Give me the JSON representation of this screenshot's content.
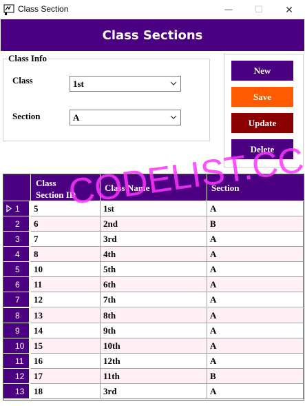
{
  "window": {
    "title": "Class Section",
    "controls": {
      "minimize": "—",
      "maximize": "☐",
      "close": "✕"
    },
    "icon": "app-icon"
  },
  "header": {
    "title": "Class Sections"
  },
  "class_info": {
    "title": "Class Info",
    "class_label": "Class",
    "class_value": "1st",
    "section_label": "Section",
    "section_value": "A"
  },
  "buttons": {
    "new": {
      "label": "New",
      "color": "#4b0082"
    },
    "save": {
      "label": "Save",
      "color": "#ff5a00"
    },
    "update": {
      "label": "Update",
      "color": "#8b0000"
    },
    "delete": {
      "label": "Delete",
      "color": "#4b0082"
    }
  },
  "table": {
    "columns": [
      "Class\nSection ID",
      "Class Name",
      "Section"
    ],
    "rows": [
      {
        "num": "1",
        "id": "5",
        "name": "1st",
        "section": "A"
      },
      {
        "num": "2",
        "id": "6",
        "name": "2nd",
        "section": "B"
      },
      {
        "num": "3",
        "id": "7",
        "name": "3rd",
        "section": "A"
      },
      {
        "num": "4",
        "id": "8",
        "name": "4th",
        "section": "A"
      },
      {
        "num": "5",
        "id": "10",
        "name": "5th",
        "section": "A"
      },
      {
        "num": "6",
        "id": "11",
        "name": "6th",
        "section": "A"
      },
      {
        "num": "7",
        "id": "12",
        "name": "7th",
        "section": "A"
      },
      {
        "num": "8",
        "id": "13",
        "name": "8th",
        "section": "A"
      },
      {
        "num": "9",
        "id": "14",
        "name": "9th",
        "section": "A"
      },
      {
        "num": "10",
        "id": "15",
        "name": "10th",
        "section": "A"
      },
      {
        "num": "11",
        "id": "16",
        "name": "12th",
        "section": "A"
      },
      {
        "num": "12",
        "id": "17",
        "name": "11th",
        "section": "B"
      },
      {
        "num": "13",
        "id": "18",
        "name": "3rd",
        "section": "A"
      }
    ],
    "selected_row": 1
  },
  "watermark": "CODELIST.CC",
  "colors": {
    "accent": "#4b0082",
    "alt_row": "#fff0f5"
  }
}
